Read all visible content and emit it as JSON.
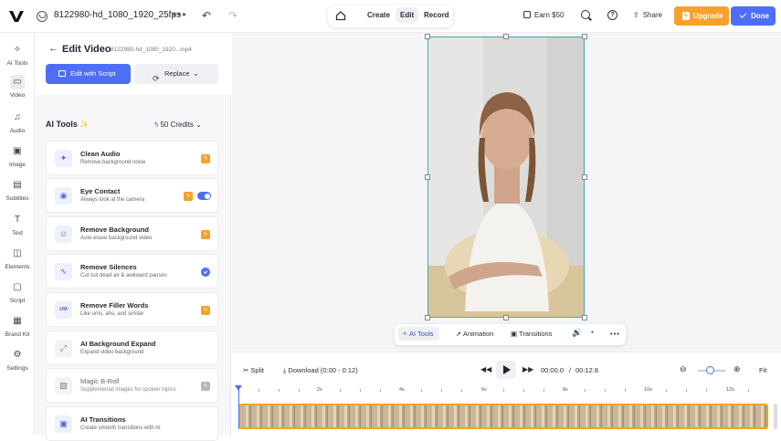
{
  "topbar": {
    "project_name": "8122980-hd_1080_1920_25fps",
    "tabs": [
      "Create",
      "Edit",
      "Record"
    ],
    "active_tab": "Edit",
    "earn_label": "Earn $50",
    "share_label": "Share",
    "upgrade_label": "Upgrade",
    "done_label": "Done"
  },
  "sidebar": {
    "items": [
      {
        "label": "AI Tools",
        "icon": "sparkle-icon"
      },
      {
        "label": "Video",
        "icon": "video-icon"
      },
      {
        "label": "Audio",
        "icon": "music-note-icon"
      },
      {
        "label": "Image",
        "icon": "image-icon"
      },
      {
        "label": "Subtitles",
        "icon": "captions-icon"
      },
      {
        "label": "Text",
        "icon": "text-icon"
      },
      {
        "label": "Elements",
        "icon": "shapes-icon"
      },
      {
        "label": "Script",
        "icon": "script-icon"
      },
      {
        "label": "Brand Kit",
        "icon": "brand-kit-icon"
      },
      {
        "label": "Settings",
        "icon": "gear-icon"
      }
    ],
    "active": "Video"
  },
  "panel": {
    "title": "Edit Video",
    "file": "8122980-hd_1080_1920...mp4",
    "edit_script_label": "Edit with Script",
    "replace_label": "Replace",
    "tools_heading": "AI Tools",
    "credits_label": "50 Credits",
    "tools": [
      {
        "title": "Clean Audio",
        "desc": "Remove background noise",
        "icon": "clean-audio-icon",
        "state": "pro"
      },
      {
        "title": "Eye Contact",
        "desc": "Always look at the camera",
        "icon": "eye-icon",
        "state": "toggle-on"
      },
      {
        "title": "Remove Background",
        "desc": "Auto-erase background video",
        "icon": "person-icon",
        "state": "pro"
      },
      {
        "title": "Remove Silences",
        "desc": "Cut out dead air & awkward pauses",
        "icon": "waveform-icon",
        "state": "checked"
      },
      {
        "title": "Remove Filler Words",
        "desc": "Like ums, ahs, and similar",
        "icon": "filler-words-icon",
        "icon_text": "UM",
        "state": "pro"
      },
      {
        "title": "AI Background Expand",
        "desc": "Expand video background",
        "icon": "expand-icon",
        "state": "none"
      },
      {
        "title": "Magic B-Roll",
        "desc": "Supplemental images for spoken topics",
        "icon": "broll-icon",
        "state": "disabled-pro"
      },
      {
        "title": "AI Transitions",
        "desc": "Create smooth transitions with AI",
        "icon": "transitions-icon",
        "state": "none"
      }
    ]
  },
  "canvas_toolbar": {
    "ai_tools_label": "AI Tools",
    "animation_label": "Animation",
    "transitions_label": "Transitions"
  },
  "timeline": {
    "split_label": "Split",
    "download_label": "Download",
    "download_range": "(0:00 - 0:12)",
    "current_time": "00:00.0",
    "separator": "/",
    "total_time": "00:12.8",
    "fit_label": "Fit",
    "ruler_labels": [
      "2s",
      "4s",
      "6s",
      "8s",
      "10s",
      "12s"
    ],
    "zoom_level": 0.5
  }
}
